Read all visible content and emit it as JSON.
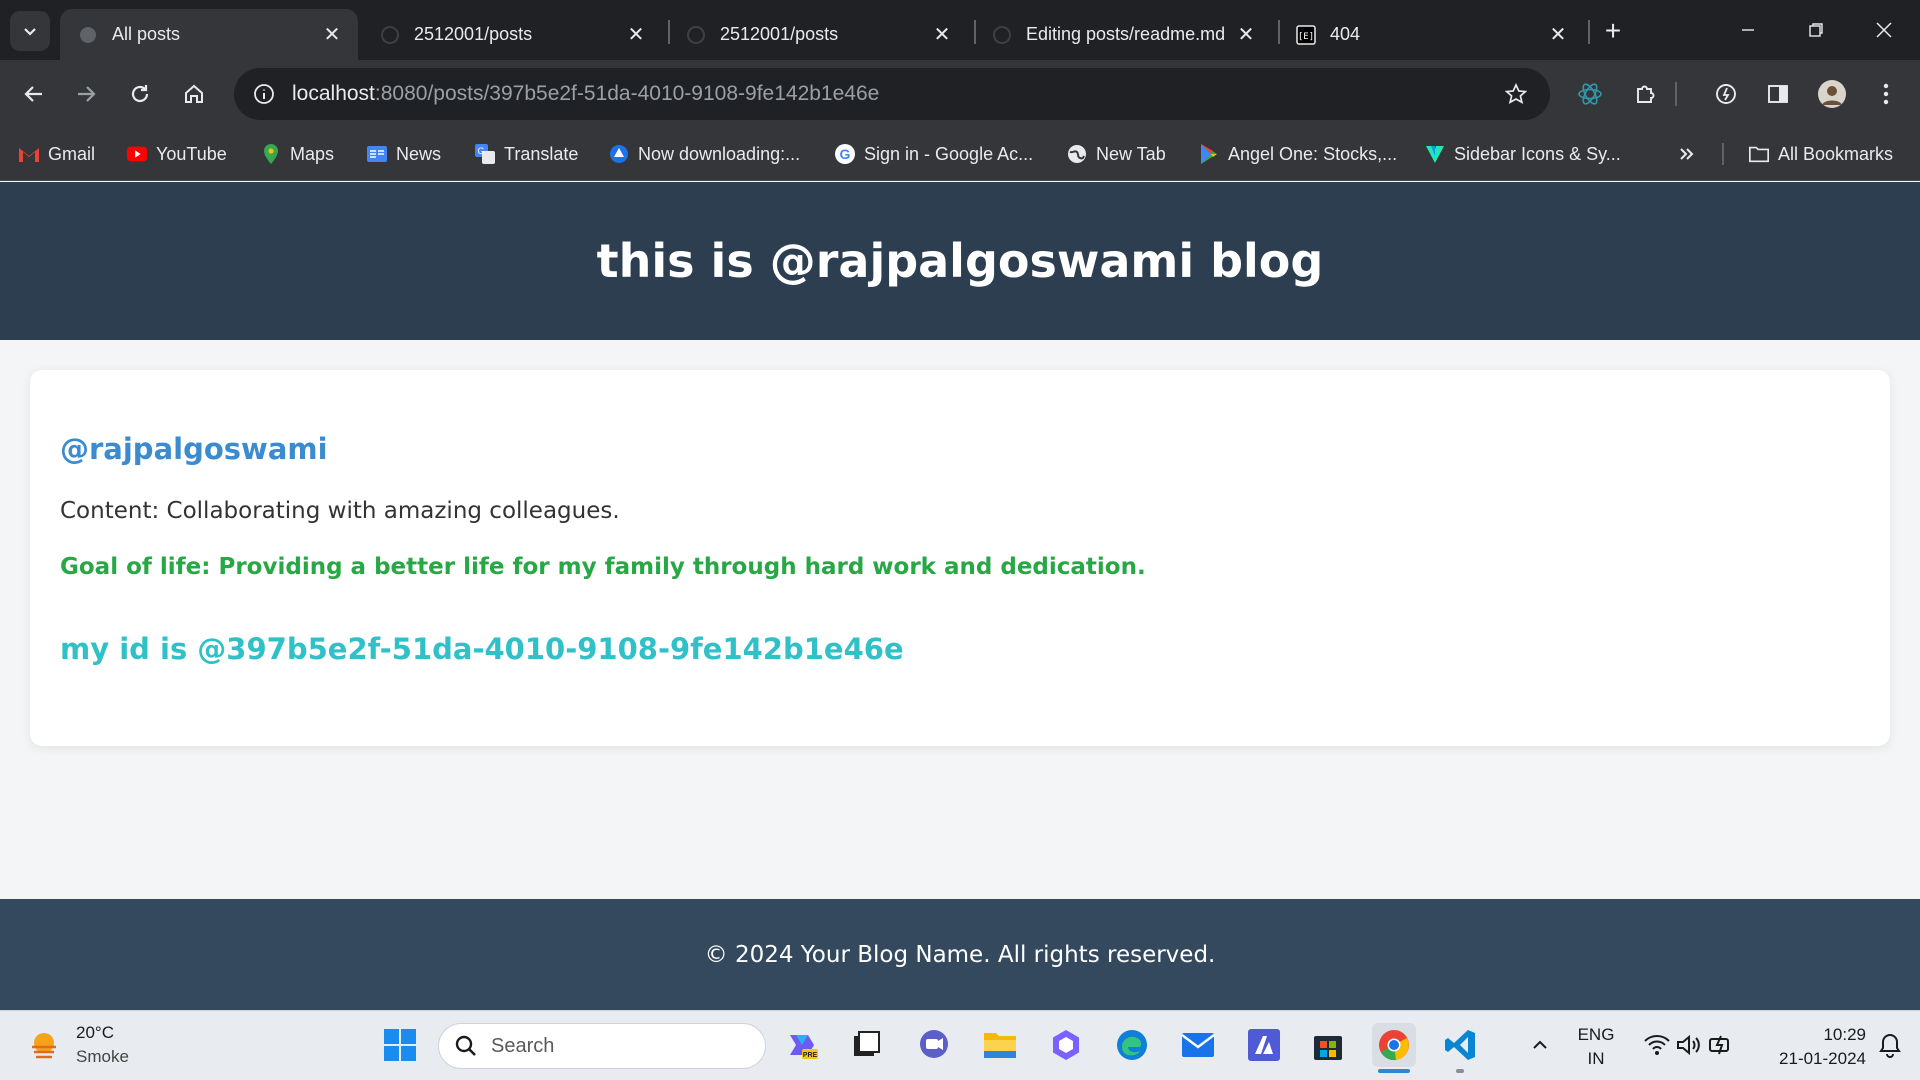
{
  "browser": {
    "tabs": [
      {
        "title": "All posts",
        "active": true
      },
      {
        "title": "2512001/posts",
        "active": false
      },
      {
        "title": "2512001/posts",
        "active": false
      },
      {
        "title": "Editing posts/readme.md",
        "active": false
      },
      {
        "title": "404",
        "active": false
      }
    ],
    "url_host": "localhost",
    "url_path": ":8080/posts/397b5e2f-51da-4010-9108-9fe142b1e46e",
    "bookmarks": [
      {
        "label": "Gmail",
        "icon": "gmail-icon"
      },
      {
        "label": "YouTube",
        "icon": "youtube-icon"
      },
      {
        "label": "Maps",
        "icon": "maps-icon"
      },
      {
        "label": "News",
        "icon": "news-icon"
      },
      {
        "label": "Translate",
        "icon": "translate-icon"
      },
      {
        "label": "Now downloading:...",
        "icon": "drive-icon"
      },
      {
        "label": "Sign in - Google Ac...",
        "icon": "google-icon"
      },
      {
        "label": "New Tab",
        "icon": "globe-icon"
      },
      {
        "label": "Angel One: Stocks,...",
        "icon": "play-store-icon"
      },
      {
        "label": "Sidebar Icons & Sy...",
        "icon": "vuetify-icon"
      }
    ],
    "all_bookmarks": "All Bookmarks"
  },
  "page": {
    "header_title": "this is @rajpalgoswami blog",
    "post": {
      "author": "@rajpalgoswami",
      "content": "Content: Collaborating with amazing colleagues.",
      "goal": "Goal of life: Providing a better life for my family through hard work and dedication.",
      "id_line": "my id is @397b5e2f-51da-4010-9108-9fe142b1e46e"
    },
    "footer": "© 2024 Your Blog Name. All rights reserved."
  },
  "taskbar": {
    "weather_temp": "20°C",
    "weather_desc": "Smoke",
    "search_placeholder": "Search",
    "lang_top": "ENG",
    "lang_bottom": "IN",
    "time": "10:29",
    "date": "21-01-2024"
  },
  "colors": {
    "header_bg": "#2c3e50",
    "footer_bg": "#34495e",
    "author": "#3a8bd0",
    "goal": "#28a745",
    "post_id": "#2fc0c8"
  }
}
